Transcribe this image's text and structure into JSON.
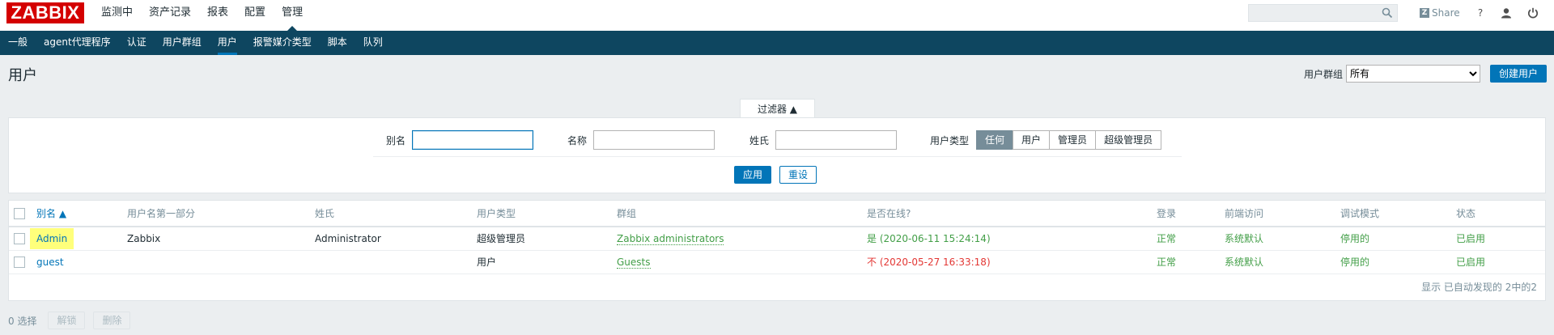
{
  "brand": "ZABBIX",
  "main_menu": [
    "监测中",
    "资产记录",
    "报表",
    "配置",
    "管理"
  ],
  "topbar": {
    "share_label": "Share",
    "help": "?"
  },
  "sub_menu": [
    "一般",
    "agent代理程序",
    "认证",
    "用户群组",
    "用户",
    "报警媒介类型",
    "脚本",
    "队列"
  ],
  "header": {
    "title": "用户",
    "group_label": "用户群组",
    "group_selected": "所有",
    "create_button": "创建用户"
  },
  "filter": {
    "tab_label": "过滤器",
    "tab_arrow": "▲",
    "alias_label": "别名",
    "name_label": "名称",
    "surname_label": "姓氏",
    "type_label": "用户类型",
    "type_options": [
      "任何",
      "用户",
      "管理员",
      "超级管理员"
    ],
    "type_selected": "任何",
    "apply": "应用",
    "reset": "重设"
  },
  "table": {
    "headers": [
      "别名 ▲",
      "用户名第一部分",
      "姓氏",
      "用户类型",
      "群组",
      "是否在线?",
      "登录",
      "前端访问",
      "调试模式",
      "状态"
    ],
    "rows": [
      {
        "alias": "Admin",
        "name": "Zabbix",
        "surname": "Administrator",
        "type": "超级管理员",
        "groups": "Zabbix administrators",
        "online": "是 (2020-06-11 15:24:14)",
        "login": "正常",
        "frontend": "系统默认",
        "debug": "停用的",
        "status": "已启用"
      },
      {
        "alias": "guest",
        "name": "",
        "surname": "",
        "type": "用户",
        "groups": "Guests",
        "online": "不 (2020-05-27 16:33:18)",
        "login": "正常",
        "frontend": "系统默认",
        "debug": "停用的",
        "status": "已启用"
      }
    ],
    "footer": "显示 已自动发现的 2中的2"
  },
  "bottom": {
    "selected": "0 选择",
    "unblock": "解锁",
    "delete": "删除"
  },
  "colors": {
    "brand_red": "#d40000",
    "nav_blue": "#0e4660",
    "accent": "#0275b8",
    "ok_green": "#429e47",
    "bad_red": "#e33734",
    "highlight": "#ffff7b"
  }
}
